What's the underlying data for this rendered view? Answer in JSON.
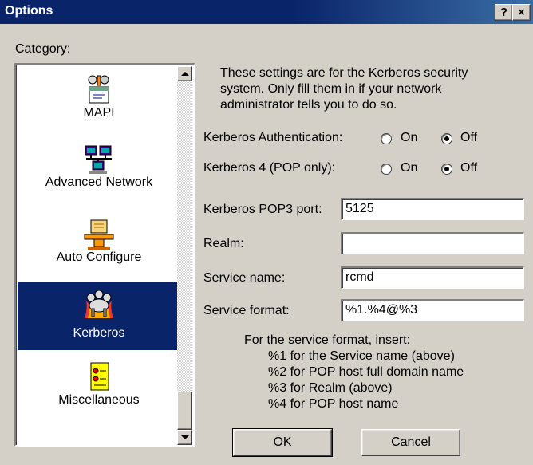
{
  "window": {
    "title": "Options",
    "help_label": "?",
    "close_label": "×"
  },
  "category": {
    "label": "Category:",
    "items": [
      {
        "label": "MAPI",
        "icon": "mapi-icon",
        "selected": false
      },
      {
        "label": "Advanced Network",
        "icon": "network-icon",
        "selected": false
      },
      {
        "label": "Auto Configure",
        "icon": "auto-configure-icon",
        "selected": false
      },
      {
        "label": "Kerberos",
        "icon": "kerberos-dog-icon",
        "selected": true
      },
      {
        "label": "Miscellaneous",
        "icon": "miscellaneous-icon",
        "selected": false
      }
    ]
  },
  "description": "These settings are for the Kerberos security system. Only fill them in if your network administrator tells you to do so.",
  "auth": {
    "label": "Kerberos Authentication:",
    "on": "On",
    "off": "Off",
    "value": "Off"
  },
  "k4": {
    "label": "Kerberos 4 (POP only):",
    "on": "On",
    "off": "Off",
    "value": "Off"
  },
  "fields": {
    "pop3_port": {
      "label": "Kerberos POP3 port:",
      "value": "5125"
    },
    "realm": {
      "label": "Realm:",
      "value": ""
    },
    "service_name": {
      "label": "Service name:",
      "value": "rcmd"
    },
    "service_format": {
      "label": "Service format:",
      "value": "%1.%4@%3"
    }
  },
  "help": {
    "intro": "For the service format, insert:",
    "lines": [
      "%1 for the Service name (above)",
      "%2 for POP host full domain name",
      "%3 for Realm (above)",
      "%4 for POP host name"
    ]
  },
  "buttons": {
    "ok": "OK",
    "cancel": "Cancel"
  },
  "colors": {
    "title_bar": "#0a246a",
    "selection": "#0a246a",
    "face": "#d4d0c8"
  }
}
